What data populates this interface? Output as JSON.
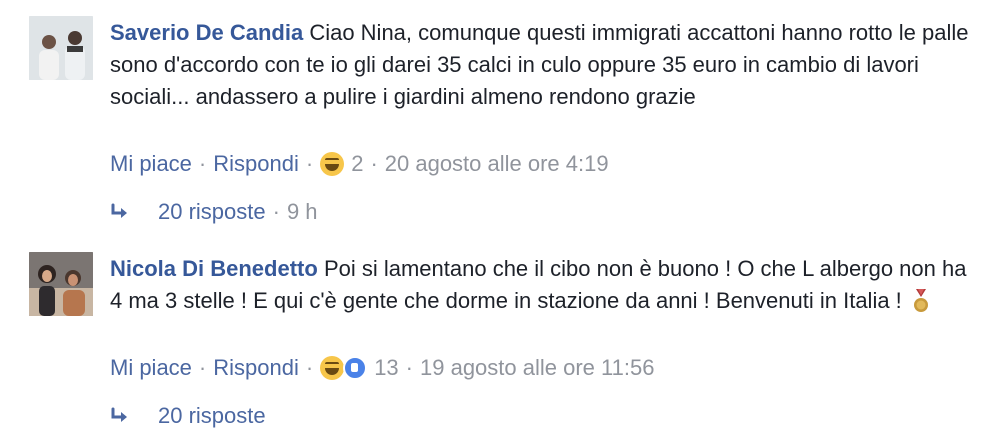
{
  "comments": [
    {
      "author": "Saverio De Candia",
      "text": "Ciao Nina, comunque questi immigrati accattoni hanno rotto le palle sono d'accordo con te io gli darei 35 calci in culo oppure 35 euro in cambio di lavori sociali... andassero a pulire i giardini almeno rendono grazie",
      "like_label": "Mi piace",
      "reply_label": "Rispondi",
      "reaction_icons": [
        "haha-emoji-icon"
      ],
      "reaction_count": "2",
      "timestamp": "20 agosto alle ore 4:19",
      "replies_label": "20 risposte",
      "replies_time": "9 h"
    },
    {
      "author": "Nicola Di Benedetto",
      "text": "Poi si lamentano che il cibo non è buono ! O che L albergo non ha 4 ma 3 stelle ! E qui c'è gente che dorme in stazione da anni ! Benvenuti in Italia !",
      "like_label": "Mi piace",
      "reply_label": "Rispondi",
      "reaction_icons": [
        "haha-emoji-icon",
        "like-icon"
      ],
      "reaction_count": "13",
      "timestamp": "19 agosto alle ore 11:56",
      "replies_label": "20 risposte"
    }
  ],
  "separator": "·",
  "colors": {
    "author": "#365899",
    "link": "#4b67a1",
    "muted": "#90949c",
    "text": "#1d2129"
  }
}
